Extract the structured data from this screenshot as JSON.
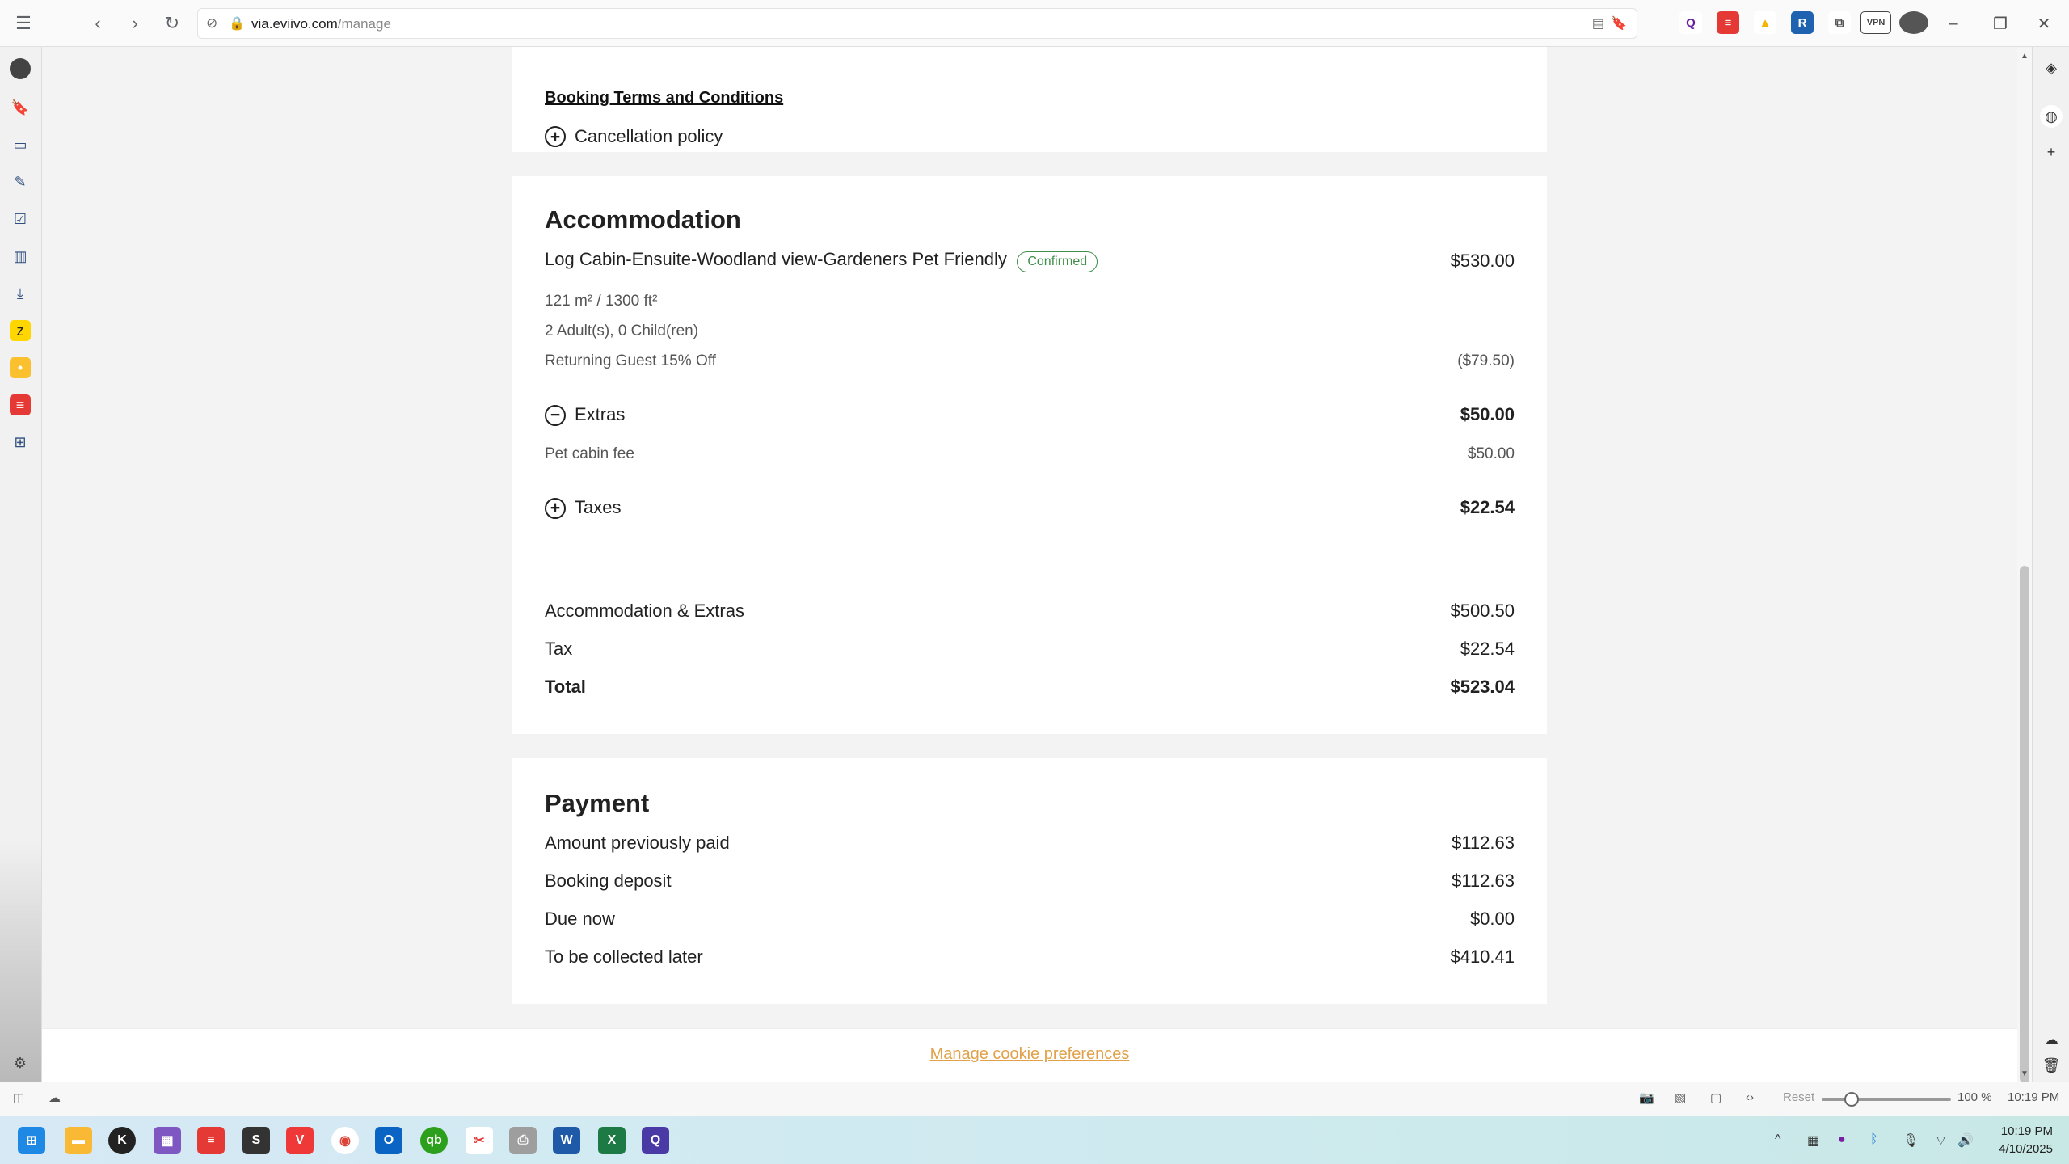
{
  "browser": {
    "url_host": "via.eviivo.com",
    "url_path": "/manage",
    "zoom": "100 %",
    "reset_label": "Reset",
    "time_status": "10:19 PM",
    "vpn_label": "VPN"
  },
  "terms": {
    "link_label": "Booking Terms and Conditions",
    "cancellation_label": "Cancellation policy"
  },
  "accommodation": {
    "heading": "Accommodation",
    "room_name": "Log Cabin-Ensuite-Woodland view-Gardeners Pet Friendly",
    "status": "Confirmed",
    "room_price": "$530.00",
    "size": "121 m² / 1300 ft²",
    "guests": "2 Adult(s), 0 Child(ren)",
    "discount_label": "Returning Guest 15% Off",
    "discount_value": "($79.50)",
    "extras_label": "Extras",
    "extras_total": "$50.00",
    "extra_item_label": "Pet cabin fee",
    "extra_item_value": "$50.00",
    "taxes_label": "Taxes",
    "taxes_total": "$22.54",
    "summary": [
      {
        "label": "Accommodation & Extras",
        "value": "$500.50"
      },
      {
        "label": "Tax",
        "value": "$22.54"
      },
      {
        "label": "Total",
        "value": "$523.04"
      }
    ]
  },
  "payment": {
    "heading": "Payment",
    "rows": [
      {
        "label": "Amount previously paid",
        "value": "$112.63"
      },
      {
        "label": "Booking deposit",
        "value": "$112.63"
      },
      {
        "label": "Due now",
        "value": "$0.00"
      },
      {
        "label": "To be collected later",
        "value": "$410.41"
      }
    ]
  },
  "footer": {
    "cookie_link": "Manage cookie preferences"
  },
  "taskbar": {
    "time": "10:19 PM",
    "date": "4/10/2025"
  }
}
